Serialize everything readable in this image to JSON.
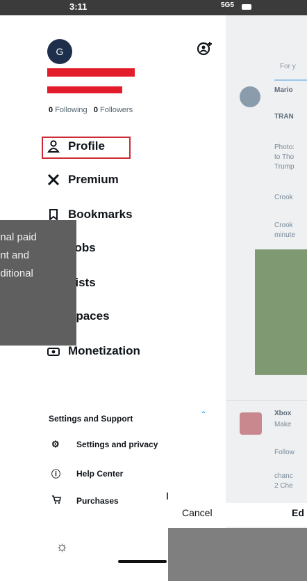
{
  "status_bar": {
    "time": "3:11",
    "network": "5G5"
  },
  "drawer": {
    "avatar_letter": "G",
    "following_count": "0",
    "following_label": "Following",
    "followers_count": "0",
    "followers_label": "Followers",
    "menu": [
      {
        "label": "Profile",
        "icon": "person-icon"
      },
      {
        "label": "Premium",
        "icon": "x-logo-icon"
      },
      {
        "label": "Bookmarks",
        "icon": "bookmark-icon"
      },
      {
        "label": "Jobs",
        "icon": "briefcase-icon"
      },
      {
        "label": "Lists",
        "icon": "list-icon"
      },
      {
        "label": "Spaces",
        "icon": "spaces-icon"
      },
      {
        "label": "Monetization",
        "icon": "money-icon"
      }
    ],
    "settings_header": "Settings and Support",
    "settings_items": [
      {
        "label": "Settings and privacy",
        "icon": "gear-icon"
      },
      {
        "label": "Help Center",
        "icon": "help-icon"
      },
      {
        "label": "Purchases",
        "icon": "cart-icon"
      }
    ]
  },
  "tooltip": {
    "lines": [
      "onal paid",
      "unt and",
      "dditional"
    ]
  },
  "feed": {
    "tab": "For y",
    "post1": {
      "name": "Mario",
      "line2": "TRAN"
    },
    "texts": [
      "Photo:",
      "to Tho",
      "Trump",
      "Crook",
      "Crook",
      "minute"
    ],
    "post2": {
      "name": "Xbox",
      "line2": "Make",
      "follow": "Follow",
      "t1": "chanc",
      "t2": "2 Che"
    }
  },
  "sheet": {
    "cancel": "Cancel",
    "edit": "Ed"
  },
  "colors": {
    "highlight_box": "#cc2b35",
    "redaction": "#e31c2b",
    "accent": "#1d9bf0"
  }
}
